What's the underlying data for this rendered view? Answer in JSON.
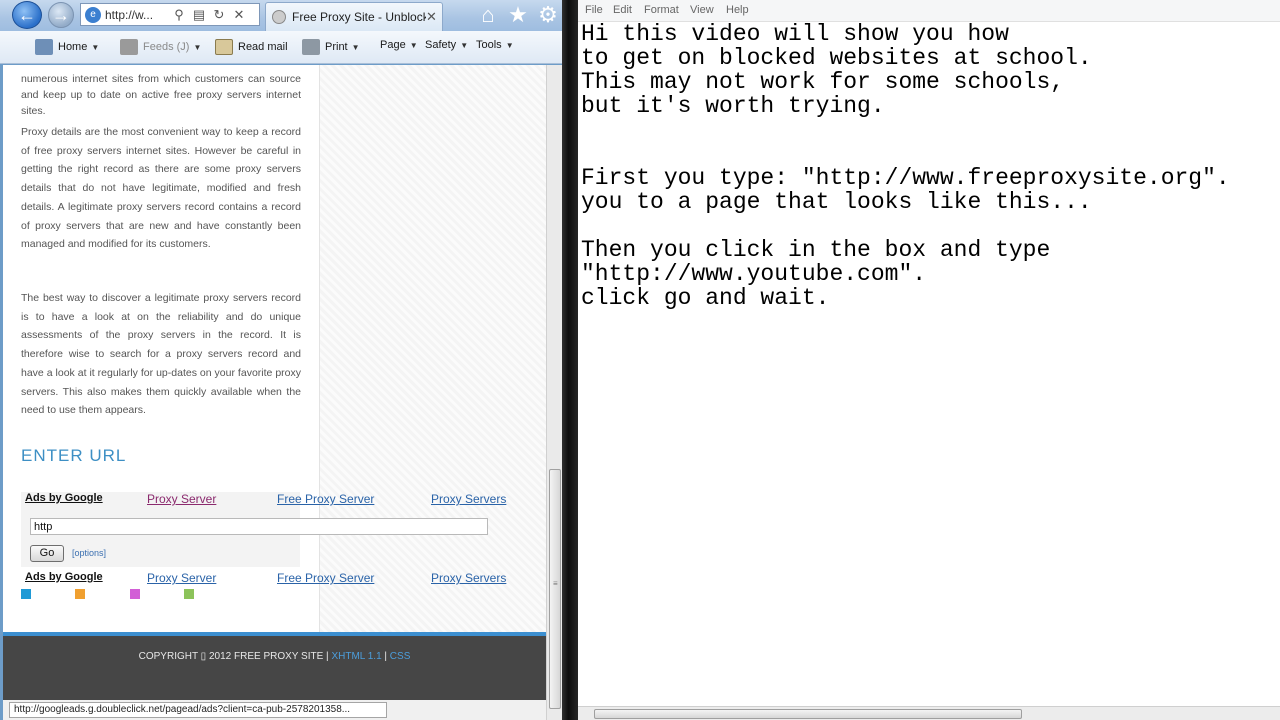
{
  "browser": {
    "address": "http://w...",
    "address_icons": [
      "search-icon",
      "compat-icon",
      "refresh-icon",
      "stop-icon"
    ],
    "tab_title": "Free Proxy Site - Unblock ...",
    "tab_close": "✕",
    "command_bar": {
      "home": "Home",
      "feeds": "Feeds (J)",
      "read_mail": "Read mail",
      "print": "Print",
      "page": "Page",
      "safety": "Safety",
      "tools": "Tools"
    },
    "status_url": "http://googleads.g.doubleclick.net/pagead/ads?client=ca-pub-2578201358..."
  },
  "page": {
    "paragraphs": [
      "numerous internet sites from which customers can source and keep up to date on active free proxy servers internet sites.",
      "Proxy details are the most convenient way to keep a record of free proxy servers internet sites. However be careful in getting the right record as there are some proxy servers details that do not have legitimate, modified and fresh details. A legitimate proxy servers record contains a record of proxy servers that are new and have constantly been managed and modified for its customers.",
      "The best way to discover a legitimate proxy servers record is to have a look at on the reliability and do unique assessments of the proxy servers in the record. It is therefore wise to search for a proxy servers record and have a look at it regularly for up-dates on your favorite proxy servers. This also makes them quickly available when the need to use them appears."
    ],
    "enter_url_heading": "ENTER URL",
    "ads_by": "Ads by Google",
    "ad_links": [
      "Proxy Server",
      "Free Proxy Server",
      "Proxy Servers"
    ],
    "url_input_value": "http",
    "go_label": "Go",
    "options_label": "[options]",
    "square_colors": [
      "#1f9ad6",
      "#f0a030",
      "#d25fd6",
      "#8cc35a"
    ],
    "footer": {
      "copyright": "COPYRIGHT ▯ 2012 FREE PROXY SITE | ",
      "xhtml": "XHTML 1.1",
      "sep": " | ",
      "css": "CSS"
    }
  },
  "notepad": {
    "menu": [
      "File",
      "Edit",
      "Format",
      "View",
      "Help"
    ],
    "text": "Hi this video will show you how\nto get on blocked websites at school.\nThis may not work for some schools,\nbut it's worth trying.\n\n\nFirst you type: \"http://www.freeproxysite.org\".\nyou to a page that looks like this...\n\nThen you click in the box and type\n\"http://www.youtube.com\".\nclick go and wait."
  }
}
